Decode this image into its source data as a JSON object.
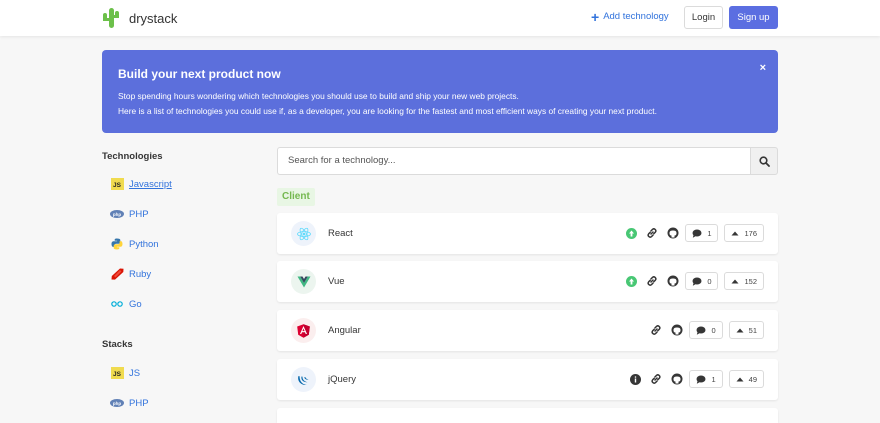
{
  "navbar": {
    "brand": "drystack",
    "add_technology": "Add technology",
    "login": "Login",
    "signup": "Sign up"
  },
  "banner": {
    "title": "Build your next product now",
    "line1": "Stop spending hours wondering which technologies you should use to build and ship your new web projects.",
    "line2": "Here is a list of technologies you could use if, as a developer, you are looking for the fastest and most efficient ways of creating your next product.",
    "close": "×"
  },
  "sidebar": {
    "technologies_heading": "Technologies",
    "technologies": [
      {
        "label": "Javascript",
        "icon": "js-icon",
        "active": true
      },
      {
        "label": "PHP",
        "icon": "php-icon"
      },
      {
        "label": "Python",
        "icon": "python-icon"
      },
      {
        "label": "Ruby",
        "icon": "ruby-icon"
      },
      {
        "label": "Go",
        "icon": "go-icon"
      }
    ],
    "stacks_heading": "Stacks",
    "stacks": [
      {
        "label": "JS",
        "icon": "js-icon"
      },
      {
        "label": "PHP",
        "icon": "php-icon"
      }
    ]
  },
  "search": {
    "placeholder": "Search for a technology..."
  },
  "category": "Client",
  "cards": [
    {
      "name": "React",
      "status": "up",
      "comments": "1",
      "votes": "176"
    },
    {
      "name": "Vue",
      "status": "up",
      "comments": "0",
      "votes": "152"
    },
    {
      "name": "Angular",
      "status": "none",
      "comments": "0",
      "votes": "51"
    },
    {
      "name": "jQuery",
      "status": "info",
      "comments": "1",
      "votes": "49"
    }
  ],
  "colors": {
    "primary": "#5c6fdc",
    "link": "#3273dc",
    "success": "#48c774",
    "category_bg": "#e8f6e4",
    "category_text": "#74b84f"
  }
}
